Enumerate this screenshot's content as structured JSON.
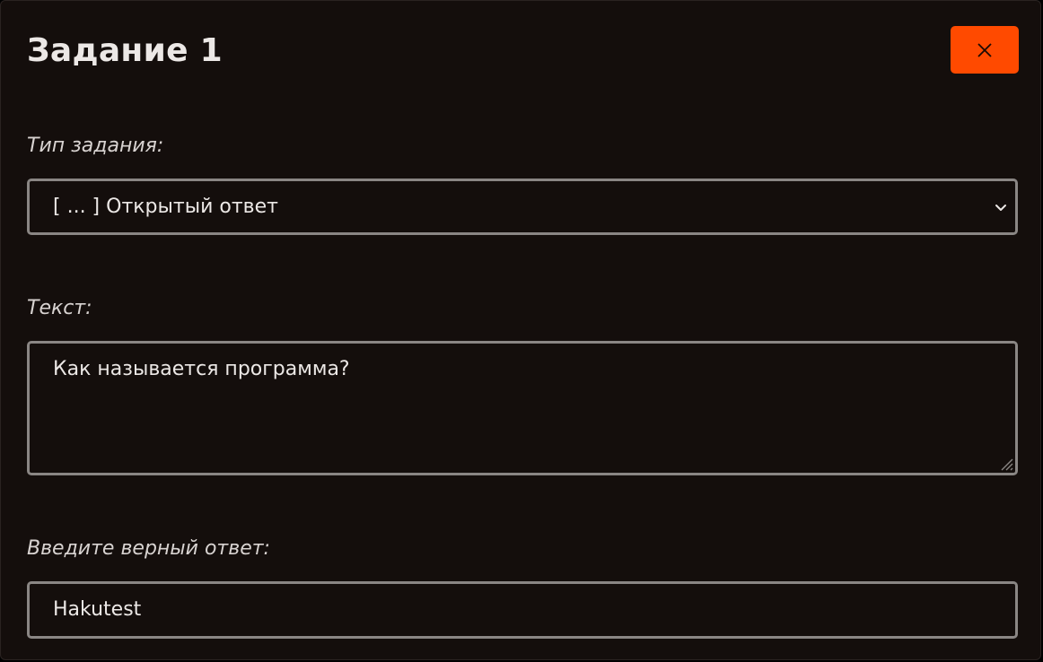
{
  "dialog": {
    "title": "Задание 1",
    "close_icon": "close-icon",
    "accent_color": "#ff4a00"
  },
  "task_type": {
    "label": "Тип задания:",
    "selected": "[ ... ] Открытый ответ",
    "icon": "chevron-down-icon"
  },
  "text": {
    "label": "Текст:",
    "value": "Как называется программа?"
  },
  "answer": {
    "label": "Введите верный ответ:",
    "value": "Hakutest"
  }
}
